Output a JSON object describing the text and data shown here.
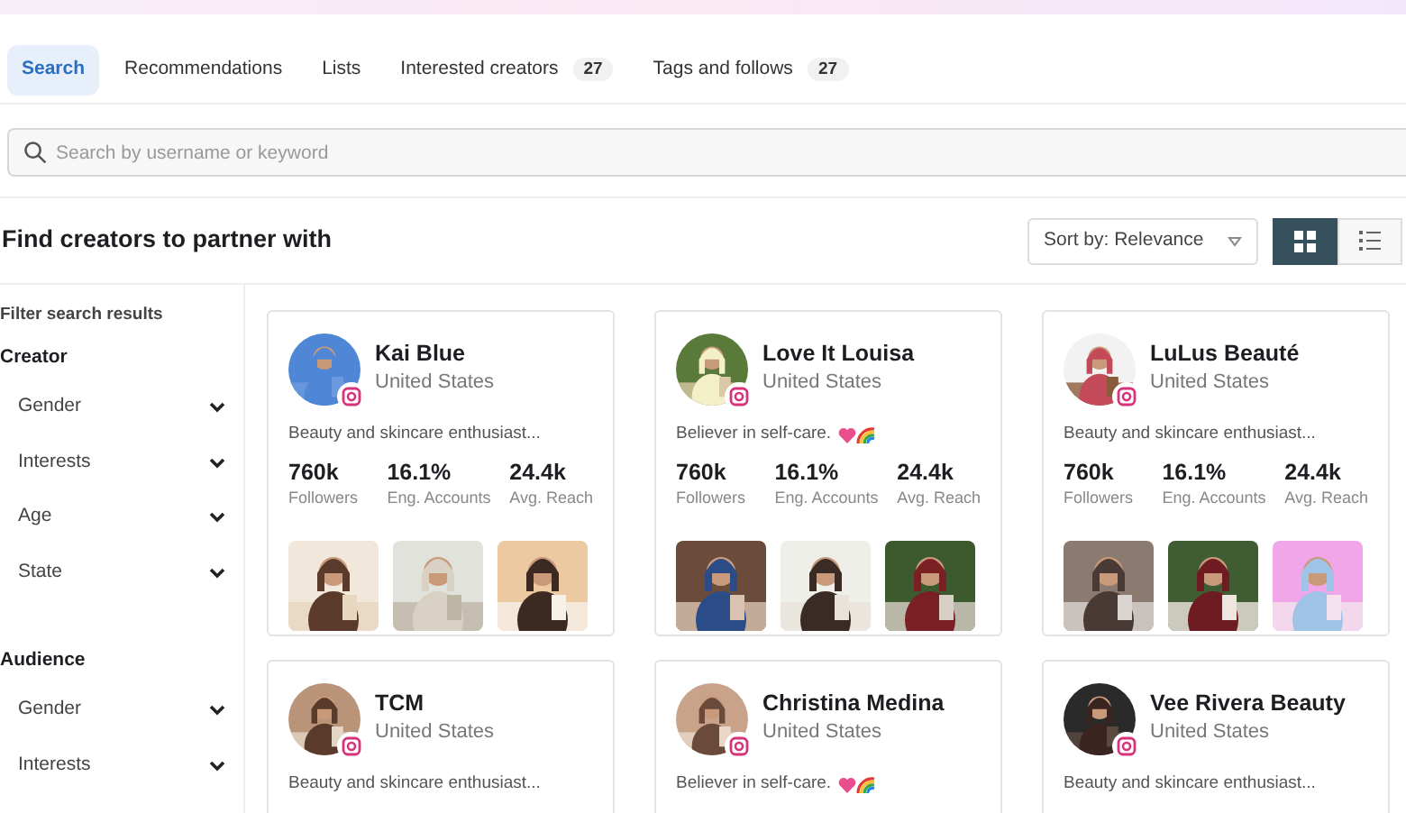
{
  "tabs": [
    {
      "label": "Search",
      "selected": true
    },
    {
      "label": "Recommendations",
      "selected": false
    },
    {
      "label": "Lists",
      "selected": false
    },
    {
      "label": "Interested creators",
      "count": "27",
      "selected": false
    },
    {
      "label": "Tags and follows",
      "count": "27",
      "selected": false
    }
  ],
  "search": {
    "placeholder": "Search by username or keyword"
  },
  "heading": "Find creators to partner with",
  "sort": {
    "label": "Sort by: Relevance"
  },
  "view_toggle": [
    {
      "kind": "grid",
      "selected": true
    },
    {
      "kind": "list",
      "selected": false
    }
  ],
  "sidebar": {
    "title": "Filter search results",
    "sections": [
      {
        "title": "Creator",
        "items": [
          {
            "label": "Gender",
            "expanded": false
          },
          {
            "label": "Interests",
            "expanded": false
          },
          {
            "label": "Age",
            "expanded": false
          },
          {
            "label": "State",
            "expanded": false
          }
        ]
      },
      {
        "title": "Audience",
        "items": [
          {
            "label": "Gender",
            "expanded": false
          },
          {
            "label": "Interests",
            "expanded": false
          }
        ]
      }
    ]
  },
  "creators": [
    {
      "name": "Kai Blue",
      "country": "United States",
      "bio": "Beauty and skincare enthusiast...",
      "stats": [
        {
          "value": "760k",
          "label": "Followers"
        },
        {
          "value": "16.1%",
          "label": "Eng. Accounts"
        },
        {
          "value": "24.4k",
          "label": "Avg. Reach"
        }
      ],
      "posts": [
        {
          "kind": "picture"
        },
        {
          "kind": "picture"
        },
        {
          "kind": "picture"
        }
      ]
    },
    {
      "name": "Love It Louisa",
      "country": "United States",
      "bio": "Believer in self-care.",
      "bio_emoji": true,
      "stats": [
        {
          "value": "760k",
          "label": "Followers"
        },
        {
          "value": "16.1%",
          "label": "Eng. Accounts"
        },
        {
          "value": "24.4k",
          "label": "Avg. Reach"
        }
      ],
      "posts": [
        {
          "kind": "picture"
        },
        {
          "kind": "picture"
        },
        {
          "kind": "picture"
        }
      ]
    },
    {
      "name": "LuLus Beauté",
      "country": "United States",
      "bio": "Beauty and skincare enthusiast...",
      "stats": [
        {
          "value": "760k",
          "label": "Followers"
        },
        {
          "value": "16.1%",
          "label": "Eng. Accounts"
        },
        {
          "value": "24.4k",
          "label": "Avg. Reach"
        }
      ],
      "posts": [
        {
          "kind": "picture"
        },
        {
          "kind": "picture"
        },
        {
          "kind": "picture"
        }
      ]
    },
    {
      "name": "TCM",
      "country": "United States",
      "bio": "Beauty and skincare enthusiast..."
    },
    {
      "name": "Christina Medina",
      "country": "United States",
      "bio": "Believer in self-care.",
      "bio_emoji": true
    },
    {
      "name": "Vee Rivera Beauty",
      "country": "United States",
      "bio": "Beauty and skincare enthusiast..."
    }
  ]
}
